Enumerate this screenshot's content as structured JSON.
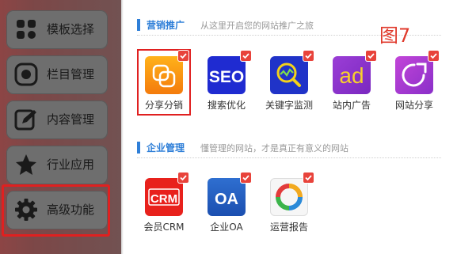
{
  "sidebar": {
    "items": [
      {
        "label": "模板选择",
        "icon": "grid-icon"
      },
      {
        "label": "栏目管理",
        "icon": "record-icon"
      },
      {
        "label": "内容管理",
        "icon": "pencil-icon"
      },
      {
        "label": "行业应用",
        "icon": "star-icon"
      },
      {
        "label": "高级功能",
        "icon": "gear-icon"
      }
    ]
  },
  "annotation": {
    "label": "图7"
  },
  "sections": [
    {
      "title": "营销推广",
      "desc": "从这里开启您的网站推广之旅",
      "apps": [
        {
          "name": "分享分销",
          "icon": "share-distribution-icon",
          "selected": true
        },
        {
          "name": "搜索优化",
          "icon": "seo-icon",
          "tile_text": "SEO"
        },
        {
          "name": "关键字监测",
          "icon": "keyword-monitor-icon"
        },
        {
          "name": "站内广告",
          "icon": "ad-icon",
          "tile_text": "ad"
        },
        {
          "name": "网站分享",
          "icon": "site-share-icon"
        }
      ]
    },
    {
      "title": "企业管理",
      "desc": "懂管理的网站，才是真正有意义的网站",
      "apps": [
        {
          "name": "会员CRM",
          "icon": "crm-icon",
          "tile_text": "CRM"
        },
        {
          "name": "企业OA",
          "icon": "oa-icon",
          "tile_text": "OA"
        },
        {
          "name": "运营报告",
          "icon": "report-icon"
        }
      ]
    }
  ],
  "colors": {
    "accent": "#2f7fd8",
    "check": "#e8433b",
    "highlight": "#e02020"
  }
}
